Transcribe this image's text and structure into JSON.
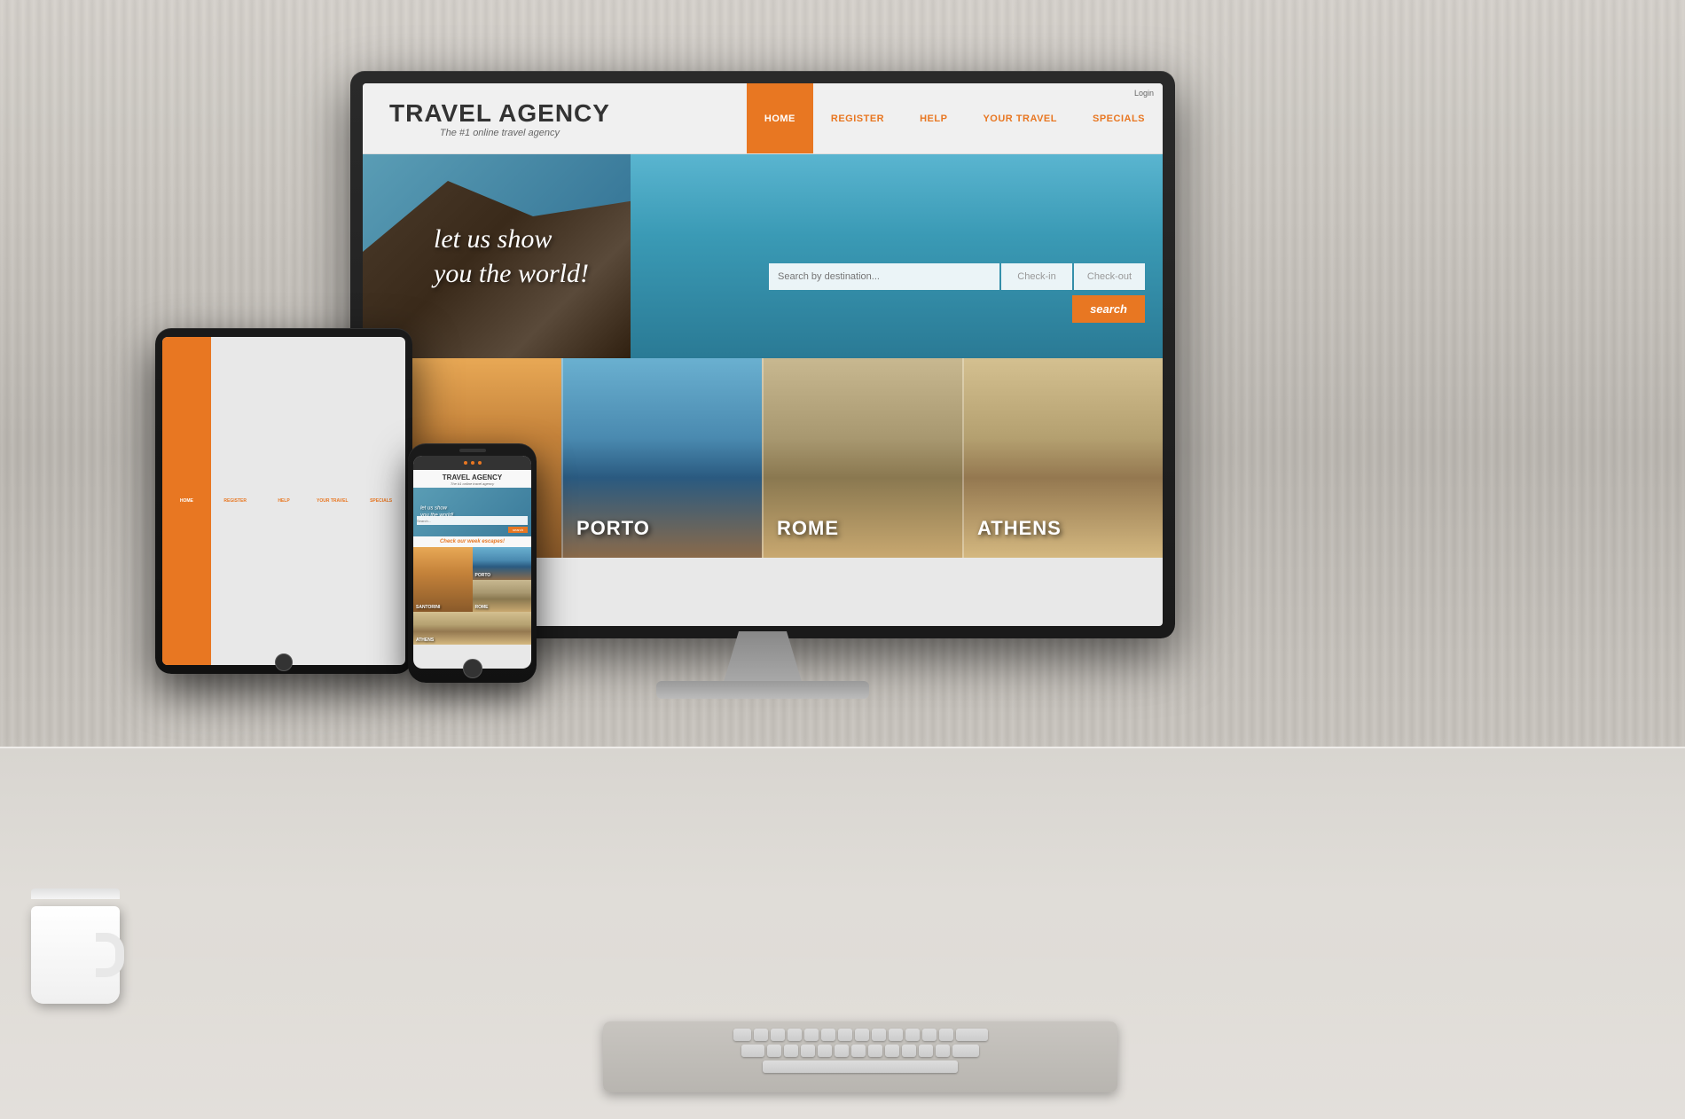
{
  "background": {
    "color": "#c8c4be"
  },
  "website": {
    "logo": {
      "title": "TRAVEL AGENCY",
      "subtitle": "The #1 online travel agency"
    },
    "nav": {
      "login_label": "Login",
      "items": [
        {
          "id": "home",
          "label": "HOME",
          "active": true
        },
        {
          "id": "register",
          "label": "REGISTER",
          "active": false
        },
        {
          "id": "help",
          "label": "HELP",
          "active": false
        },
        {
          "id": "your-travel",
          "label": "YOUR TRAVEL",
          "active": false
        },
        {
          "id": "specials",
          "label": "SPECIALS",
          "active": false
        }
      ]
    },
    "hero": {
      "tagline_line1": "let us show",
      "tagline_line2": "you the world!",
      "search_placeholder": "Search by destination...",
      "checkin_label": "Check-in",
      "checkout_label": "Check-out",
      "search_button_label": "search"
    },
    "destinations": {
      "section_title": "Check our week escapes!",
      "items": [
        {
          "id": "santorini",
          "label": "SANTORINI"
        },
        {
          "id": "porto",
          "label": "PORTO"
        },
        {
          "id": "rome",
          "label": "ROME"
        },
        {
          "id": "athens",
          "label": "ATHENS"
        }
      ]
    }
  },
  "devices": {
    "monitor": {
      "label": "Desktop Monitor"
    },
    "tablet": {
      "label": "Tablet"
    },
    "phone": {
      "label": "Smartphone"
    }
  },
  "desk_items": {
    "mug": {
      "label": "Coffee Mug"
    },
    "keyboard": {
      "label": "Keyboard"
    }
  },
  "colors": {
    "accent": "#e87722",
    "nav_active_bg": "#e87722",
    "nav_active_text": "#ffffff",
    "nav_text": "#e87722",
    "hero_search_btn": "#e87722",
    "background": "#c8c4be",
    "bezel": "#1a1a1a"
  }
}
